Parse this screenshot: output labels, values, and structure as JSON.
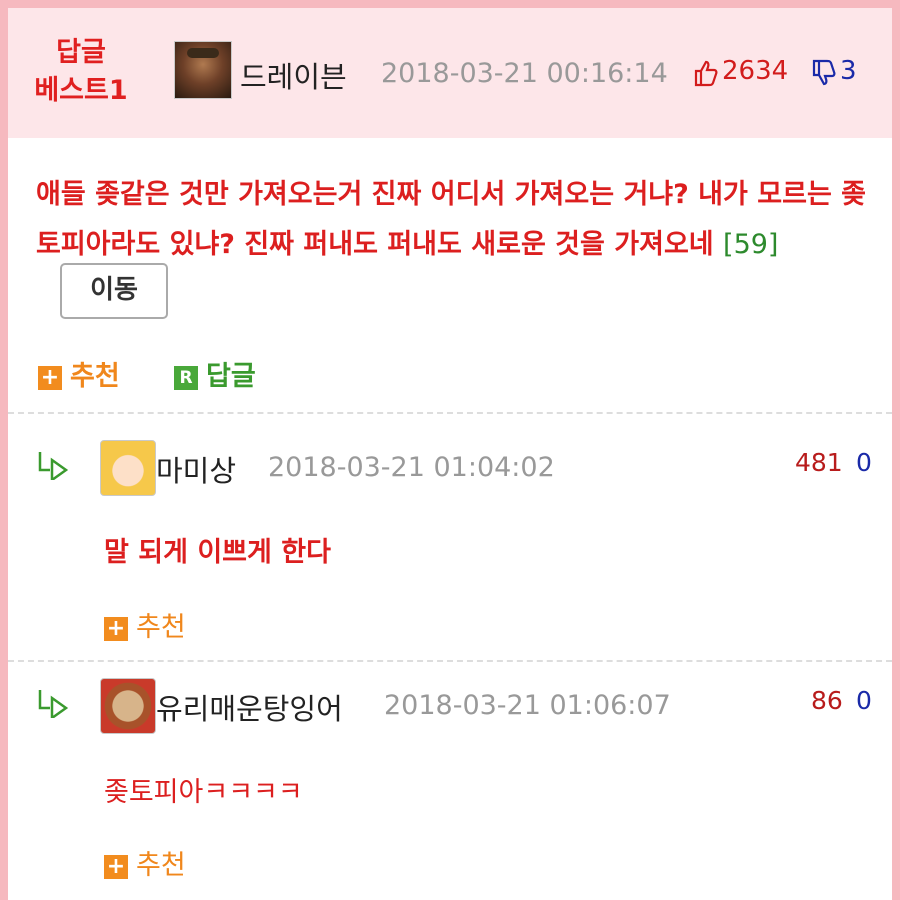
{
  "best_reply": {
    "badge_line1": "답글",
    "badge_line2": "베스트1",
    "author": "드레이븐",
    "date": "2018-03-21 00:16:14",
    "upvotes": "2634",
    "downvotes": "3",
    "content": "애들 좆같은 것만 가져오는거 진짜 어디서 가져오는 거냐? 내가 모르는 좆토피아라도 있냐? 진짜 퍼내도 퍼내도 새로운 것을 가져오네",
    "reply_count": "[59]",
    "move_button": "이동",
    "recommend_label": "추천",
    "reply_label": "답글"
  },
  "comments": [
    {
      "author": "마미상",
      "date": "2018-03-21 01:04:02",
      "upvotes": "481",
      "downvotes": "0",
      "text": "말 되게 이쁘게 한다",
      "recommend_label": "추천"
    },
    {
      "author": "유리매운탕잉어",
      "date": "2018-03-21 01:06:07",
      "upvotes": "86",
      "downvotes": "0",
      "text": "좆토피아ㅋㅋㅋㅋ",
      "recommend_label": "추천"
    }
  ],
  "icons": {
    "thumbs_up": "thumbs-up-icon",
    "thumbs_down": "thumbs-down-icon",
    "reply_arrow": "reply-arrow-icon",
    "plus": "plus-icon",
    "reply_r": "reply-r-icon"
  },
  "colors": {
    "header_bg": "#fde6e9",
    "frame_border": "#f6b9bf",
    "content_red": "#dc1f1f",
    "recommend_orange": "#f0871c",
    "reply_green": "#3a9a2e",
    "down_blue": "#1a2aa8"
  }
}
